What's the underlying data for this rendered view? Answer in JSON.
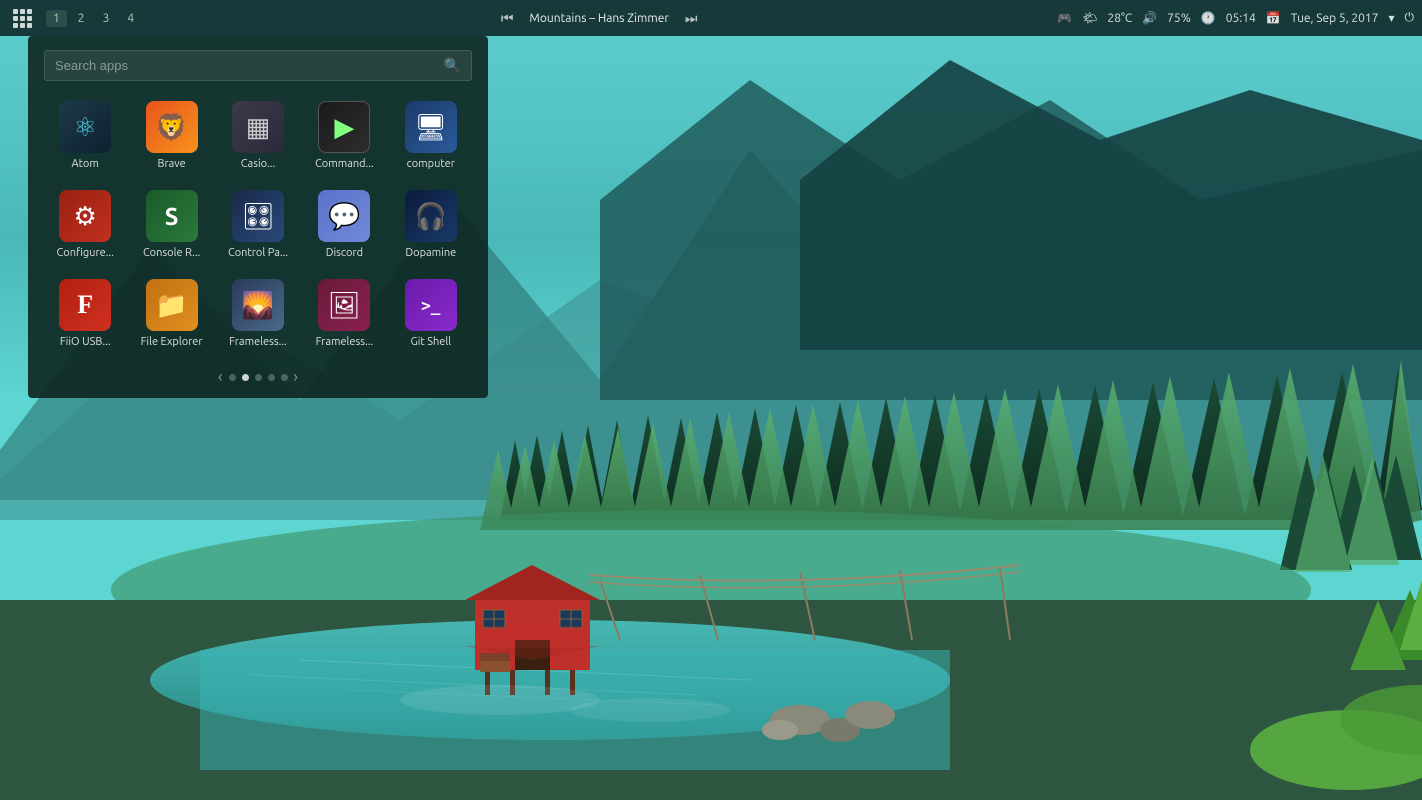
{
  "taskbar": {
    "workspaces": [
      "1",
      "2",
      "3",
      "4"
    ],
    "active_workspace": "1",
    "media": {
      "title": "Mountains – Hans Zimmer",
      "prev_icon": "⏮",
      "next_icon": "⏭"
    },
    "system": {
      "gamepad_icon": "🎮",
      "weather_icon": "🌤",
      "temperature": "28°C",
      "volume_icon": "🔊",
      "volume": "75%",
      "clock_icon": "🕐",
      "time": "05:14",
      "calendar_icon": "📅",
      "date": "Tue, Sep 5, 2017",
      "chevron_icon": "▾",
      "power_icon": "⏻"
    }
  },
  "app_launcher": {
    "search_placeholder": "Search apps",
    "apps": [
      {
        "id": "atom",
        "label": "Atom",
        "icon": "⚛",
        "icon_class": "icon-atom",
        "emoji": "⚛"
      },
      {
        "id": "brave",
        "label": "Brave",
        "icon": "🦁",
        "icon_class": "icon-brave",
        "emoji": "🦁"
      },
      {
        "id": "casio",
        "label": "Casio...",
        "icon": "🖩",
        "icon_class": "icon-casio",
        "emoji": "🖩"
      },
      {
        "id": "command",
        "label": "Command...",
        "icon": "▶",
        "icon_class": "icon-command",
        "emoji": "▶"
      },
      {
        "id": "computer",
        "label": "computer",
        "icon": "💻",
        "icon_class": "icon-computer",
        "emoji": "💻"
      },
      {
        "id": "configure",
        "label": "Configure...",
        "icon": "⚙",
        "icon_class": "icon-configure",
        "emoji": "⚙"
      },
      {
        "id": "console",
        "label": "Console R...",
        "icon": "S",
        "icon_class": "icon-console",
        "emoji": "S"
      },
      {
        "id": "control",
        "label": "Control Pa...",
        "icon": "🎛",
        "icon_class": "icon-control",
        "emoji": "🎛"
      },
      {
        "id": "discord",
        "label": "Discord",
        "icon": "💬",
        "icon_class": "icon-discord",
        "emoji": "💬"
      },
      {
        "id": "dopamine",
        "label": "Dopamine",
        "icon": "🎧",
        "icon_class": "icon-dopamine",
        "emoji": "🎧"
      },
      {
        "id": "fiio",
        "label": "FiiO USB...",
        "icon": "F",
        "icon_class": "icon-fiio",
        "emoji": "F"
      },
      {
        "id": "fileexplorer",
        "label": "File Explorer",
        "icon": "📁",
        "icon_class": "icon-fileexplorer",
        "emoji": "📁"
      },
      {
        "id": "frameless1",
        "label": "Frameless...",
        "icon": "🖼",
        "icon_class": "icon-frameless1",
        "emoji": "🖼"
      },
      {
        "id": "frameless2",
        "label": "Frameless...",
        "icon": "🖥",
        "icon_class": "icon-frameless2",
        "emoji": "🖥"
      },
      {
        "id": "gitshell",
        "label": "Git Shell",
        "icon": ">_",
        "icon_class": "icon-gitshell",
        "emoji": ">_"
      }
    ],
    "pagination": {
      "current": 2,
      "total": 5
    }
  }
}
